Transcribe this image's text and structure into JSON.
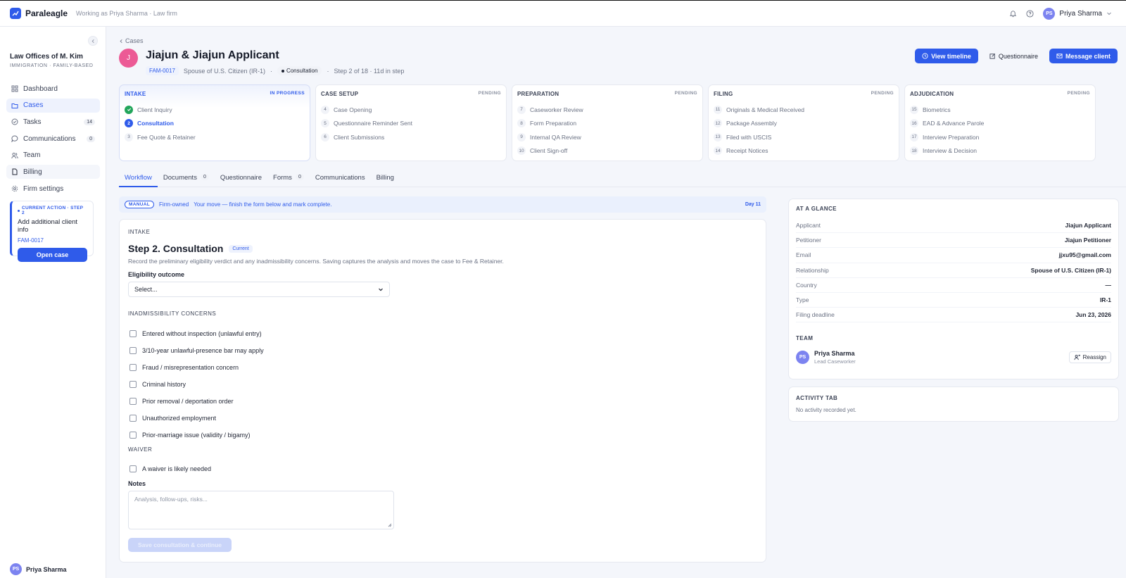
{
  "topbar": {
    "brand": "Paraleagle",
    "working_as": "Working as Priya Sharma · Law firm",
    "user_initials": "PS",
    "user_name": "Priya Sharma"
  },
  "sidebar": {
    "firm_name": "Law Offices of M. Kim",
    "firm_sub": "IMMIGRATION · FAMILY-BASED",
    "items": [
      {
        "label": "Dashboard",
        "icon": "grid-icon"
      },
      {
        "label": "Cases",
        "icon": "folder-icon"
      },
      {
        "label": "Tasks",
        "icon": "check-circle-icon",
        "count": "14"
      },
      {
        "label": "Communications",
        "icon": "chat-icon",
        "count": "0"
      },
      {
        "label": "Team",
        "icon": "users-icon"
      },
      {
        "label": "Billing",
        "icon": "file-icon"
      },
      {
        "label": "Firm settings",
        "icon": "gear-icon"
      }
    ],
    "action": {
      "label": "CURRENT ACTION · STEP 2",
      "title": "Add additional client info",
      "ref": "FAM-0017",
      "button": "Open case"
    },
    "user_initials": "PS",
    "user_name": "Priya Sharma"
  },
  "header": {
    "breadcrumb": "Cases",
    "avatar_letter": "J",
    "title": "Jiajun & Jiajun Applicant",
    "case_id": "FAM-0017",
    "relationship": "Spouse of U.S. Citizen (IR-1)",
    "stage_pill": "Consultation",
    "step_info": "Step 2 of 18 · 11d in step",
    "view_timeline": "View timeline",
    "questionnaire": "Questionnaire",
    "message_client": "Message client"
  },
  "stages": [
    {
      "name": "INTAKE",
      "status": "IN PROGRESS",
      "steps": [
        {
          "num": "1",
          "label": "Client Inquiry",
          "state": "done"
        },
        {
          "num": "2",
          "label": "Consultation",
          "state": "current"
        },
        {
          "num": "3",
          "label": "Fee Quote & Retainer",
          "state": ""
        }
      ]
    },
    {
      "name": "CASE SETUP",
      "status": "PENDING",
      "steps": [
        {
          "num": "4",
          "label": "Case Opening",
          "state": ""
        },
        {
          "num": "5",
          "label": "Questionnaire Reminder Sent",
          "state": ""
        },
        {
          "num": "6",
          "label": "Client Submissions",
          "state": ""
        }
      ]
    },
    {
      "name": "PREPARATION",
      "status": "PENDING",
      "steps": [
        {
          "num": "7",
          "label": "Caseworker Review",
          "state": ""
        },
        {
          "num": "8",
          "label": "Form Preparation",
          "state": ""
        },
        {
          "num": "9",
          "label": "Internal QA Review",
          "state": ""
        },
        {
          "num": "10",
          "label": "Client Sign-off",
          "state": ""
        }
      ]
    },
    {
      "name": "FILING",
      "status": "PENDING",
      "steps": [
        {
          "num": "11",
          "label": "Originals & Medical Received",
          "state": ""
        },
        {
          "num": "12",
          "label": "Package Assembly",
          "state": ""
        },
        {
          "num": "13",
          "label": "Filed with USCIS",
          "state": ""
        },
        {
          "num": "14",
          "label": "Receipt Notices",
          "state": ""
        }
      ]
    },
    {
      "name": "ADJUDICATION",
      "status": "PENDING",
      "steps": [
        {
          "num": "15",
          "label": "Biometrics",
          "state": ""
        },
        {
          "num": "16",
          "label": "EAD & Advance Parole",
          "state": ""
        },
        {
          "num": "17",
          "label": "Interview Preparation",
          "state": ""
        },
        {
          "num": "18",
          "label": "Interview & Decision",
          "state": ""
        }
      ]
    }
  ],
  "tabs": [
    {
      "label": "Workflow",
      "count": ""
    },
    {
      "label": "Documents",
      "count": "0"
    },
    {
      "label": "Questionnaire",
      "count": ""
    },
    {
      "label": "Forms",
      "count": "0"
    },
    {
      "label": "Communications",
      "count": ""
    },
    {
      "label": "Billing",
      "count": ""
    }
  ],
  "banner": {
    "manual": "MANUAL",
    "firm_owned": "Firm-owned",
    "your_move": "Your move — finish the form below and mark complete.",
    "day": "Day 11"
  },
  "form": {
    "section": "INTAKE",
    "title": "Step 2. Consultation",
    "current": "Current",
    "description": "Record the preliminary eligibility verdict and any inadmissibility concerns. Saving captures the analysis and moves the case to Fee & Retainer.",
    "eligibility_label": "Eligibility outcome",
    "eligibility_value": "Select...",
    "inadmissibility_label": "INADMISSIBILITY CONCERNS",
    "concerns": [
      "Entered without inspection (unlawful entry)",
      "3/10-year unlawful-presence bar may apply",
      "Fraud / misrepresentation concern",
      "Criminal history",
      "Prior removal / deportation order",
      "Unauthorized employment",
      "Prior-marriage issue (validity / bigamy)"
    ],
    "waiver_label": "WAIVER",
    "waiver_check": "A waiver is likely needed",
    "notes_label": "Notes",
    "notes_placeholder": "Analysis, follow-ups, risks...",
    "save_button": "Save consultation & continue"
  },
  "glance": {
    "heading": "AT A GLANCE",
    "rows": [
      {
        "k": "Applicant",
        "v": "Jiajun Applicant"
      },
      {
        "k": "Petitioner",
        "v": "Jiajun Petitioner"
      },
      {
        "k": "Email",
        "v": "jjxu95@gmail.com"
      },
      {
        "k": "Relationship",
        "v": "Spouse of U.S. Citizen (IR-1)"
      },
      {
        "k": "Country",
        "v": "—"
      },
      {
        "k": "Type",
        "v": "IR-1"
      },
      {
        "k": "Filing deadline",
        "v": "Jun 23, 2026"
      }
    ],
    "team_heading": "TEAM",
    "member_initials": "PS",
    "member_name": "Priya Sharma",
    "member_role": "Lead Caseworker",
    "reassign": "Reassign"
  },
  "activity": {
    "heading": "ACTIVITY TAB",
    "empty": "No activity recorded yet."
  },
  "colors": {
    "accent": "#2f5bea",
    "done": "#22a55b",
    "avatar": "#ec5a95"
  }
}
